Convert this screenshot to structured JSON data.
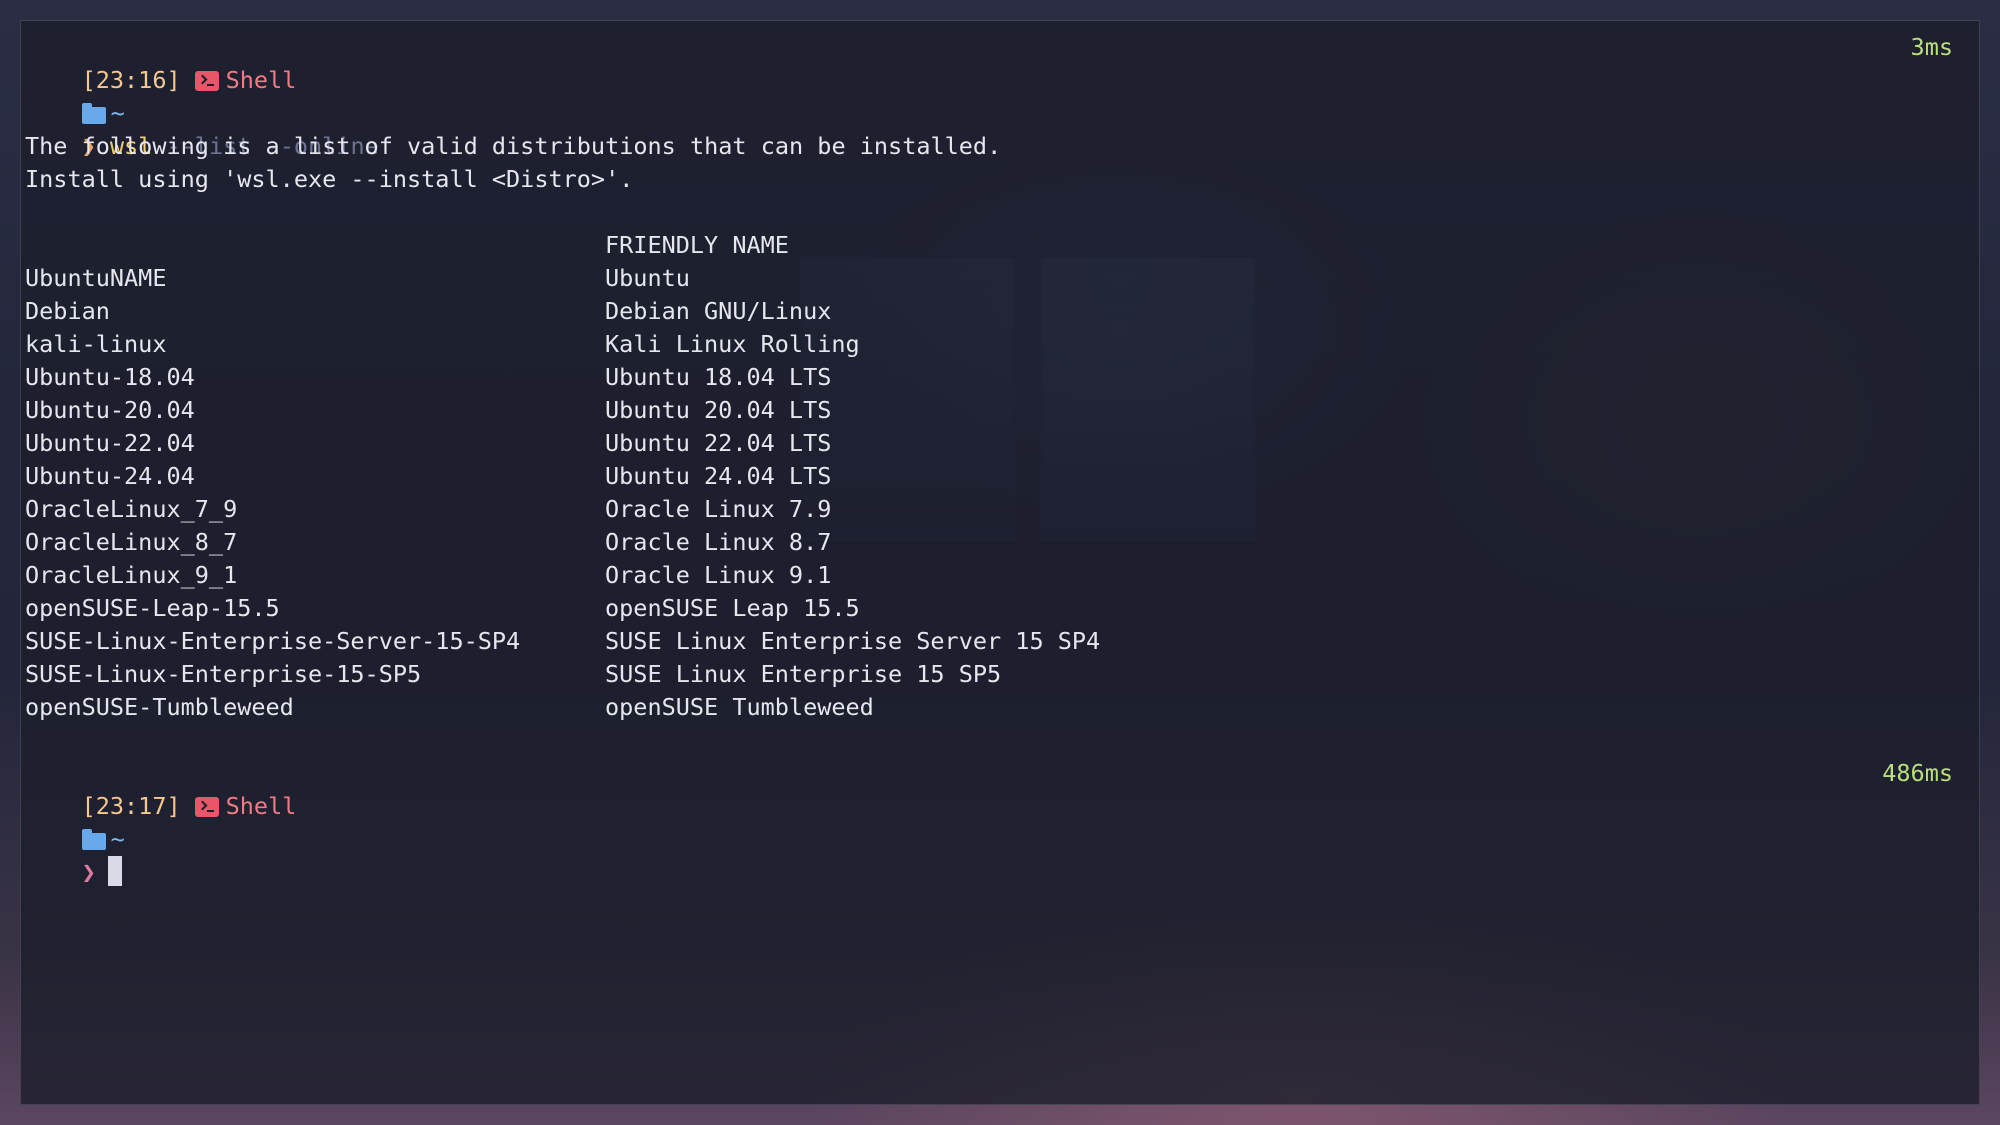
{
  "colors": {
    "timestamp": "#f5c890",
    "shell_label": "#f07b85",
    "duration": "#b9e07a",
    "folder": "#6aa8ec",
    "command": "#f2cf74",
    "args": "#6e7290"
  },
  "blocks": [
    {
      "timestamp": "[23:16]",
      "shell_label": "Shell",
      "duration": "3ms",
      "path": "~",
      "prompt_symbol": "❯",
      "command": "wsl",
      "args": "--list --online"
    },
    {
      "timestamp": "[23:17]",
      "shell_label": "Shell",
      "duration": "486ms",
      "path": "~",
      "prompt_symbol": "❯"
    }
  ],
  "output": {
    "intro1": "The following is a list of valid distributions that can be installed.",
    "intro2": "Install using 'wsl.exe --install <Distro>'.",
    "table": {
      "headers": [
        "NAME",
        "FRIENDLY NAME"
      ],
      "rows": [
        [
          "Ubuntu",
          "Ubuntu"
        ],
        [
          "Debian",
          "Debian GNU/Linux"
        ],
        [
          "kali-linux",
          "Kali Linux Rolling"
        ],
        [
          "Ubuntu-18.04",
          "Ubuntu 18.04 LTS"
        ],
        [
          "Ubuntu-20.04",
          "Ubuntu 20.04 LTS"
        ],
        [
          "Ubuntu-22.04",
          "Ubuntu 22.04 LTS"
        ],
        [
          "Ubuntu-24.04",
          "Ubuntu 24.04 LTS"
        ],
        [
          "OracleLinux_7_9",
          "Oracle Linux 7.9"
        ],
        [
          "OracleLinux_8_7",
          "Oracle Linux 8.7"
        ],
        [
          "OracleLinux_9_1",
          "Oracle Linux 9.1"
        ],
        [
          "openSUSE-Leap-15.5",
          "openSUSE Leap 15.5"
        ],
        [
          "SUSE-Linux-Enterprise-Server-15-SP4",
          "SUSE Linux Enterprise Server 15 SP4"
        ],
        [
          "SUSE-Linux-Enterprise-15-SP5",
          "SUSE Linux Enterprise 15 SP5"
        ],
        [
          "openSUSE-Tumbleweed",
          "openSUSE Tumbleweed"
        ]
      ]
    }
  }
}
